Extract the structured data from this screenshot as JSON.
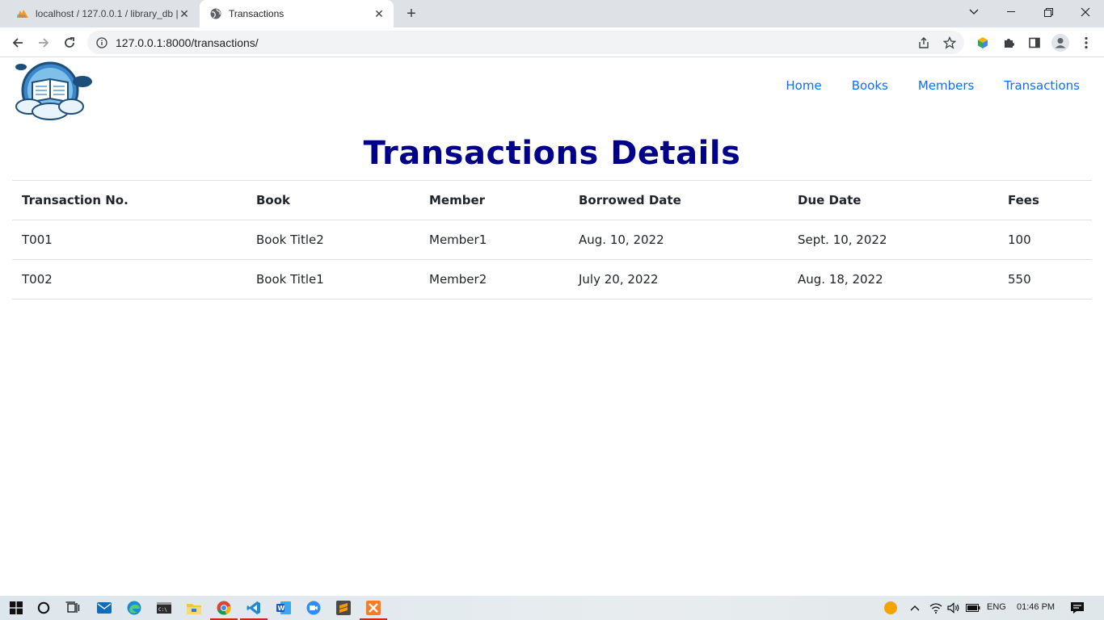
{
  "browser": {
    "tabs": [
      {
        "title": "localhost / 127.0.0.1 / library_db |",
        "active": false
      },
      {
        "title": "Transactions",
        "active": true
      }
    ],
    "url": "127.0.0.1:8000/transactions/"
  },
  "nav": {
    "links": [
      "Home",
      "Books",
      "Members",
      "Transactions"
    ]
  },
  "page": {
    "title": "Transactions Details"
  },
  "table": {
    "headers": [
      "Transaction No.",
      "Book",
      "Member",
      "Borrowed Date",
      "Due Date",
      "Fees"
    ],
    "rows": [
      [
        "T001",
        "Book Title2",
        "Member1",
        "Aug. 10, 2022",
        "Sept. 10, 2022",
        "100"
      ],
      [
        "T002",
        "Book Title1",
        "Member2",
        "July 20, 2022",
        "Aug. 18, 2022",
        "550"
      ]
    ]
  },
  "taskbar": {
    "language": "ENG",
    "time": "01:46 PM"
  },
  "colors": {
    "heading": "#00008b",
    "link": "#0d6efd"
  }
}
